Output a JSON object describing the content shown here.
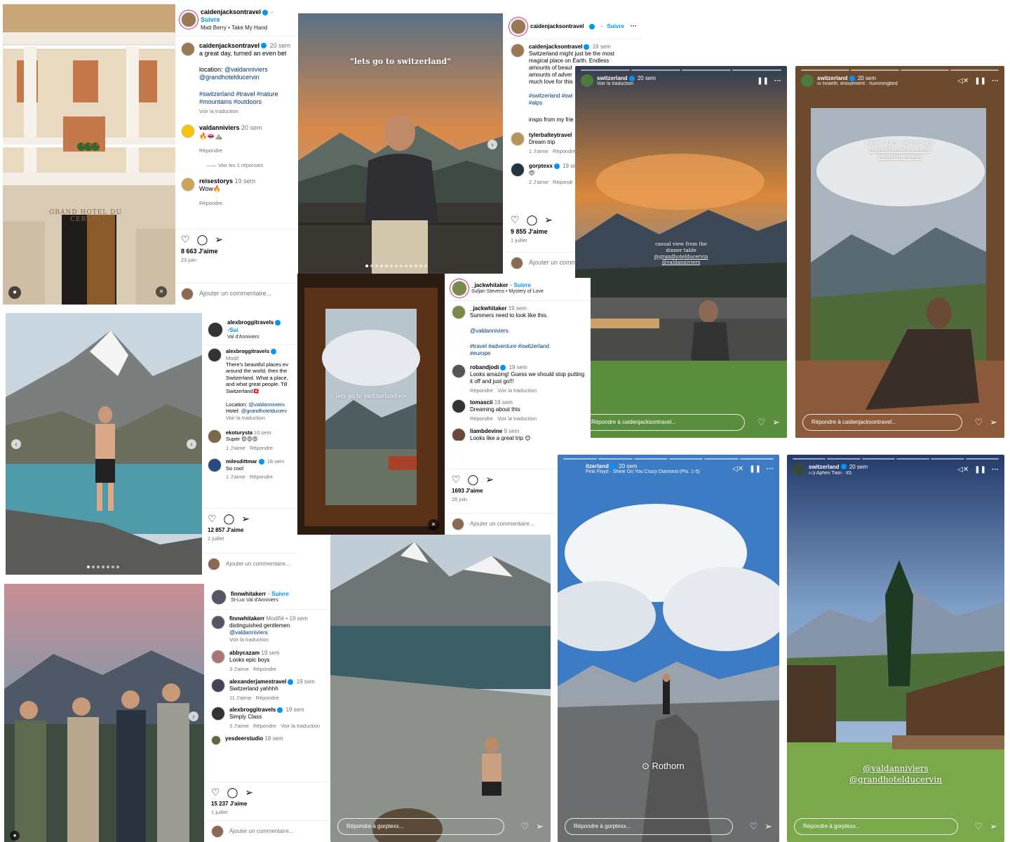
{
  "post1": {
    "username": "caidenjacksontravel",
    "follow": "Suivre",
    "song": "Matt Berry • Take My Hand",
    "caption_user": "caidenjacksontravel",
    "caption_time": "20 sem",
    "caption_text": "a great day, turned an even bet",
    "location_label": "location:",
    "location_tag1": "@valdanniviers",
    "location_tag2": "@grandhotelducervin",
    "hashtags1": "#switzerland #travel #nature",
    "hashtags2": "#mountains #outdoors",
    "translate": "Voir la traduction",
    "comments": [
      {
        "user": "valdanniviers",
        "time": "20 sem",
        "text": "🔥👄⛰️",
        "reply": "Répondre",
        "view_replies": "Voir les 1 réponses"
      },
      {
        "user": "reisestorys",
        "time": "19 sem",
        "text": "Wow🔥",
        "reply": "Répondre"
      }
    ],
    "likes": "8 663 J'aime",
    "date": "23 juin",
    "add_comment": "Ajouter un commentaire...",
    "sign_text": "GRAND HOTEL DU CERVIN"
  },
  "post2": {
    "overlay": "\"lets go to switzerland\""
  },
  "post3": {
    "username": "caidenjacksontravel",
    "follow": "Suivre",
    "caption_user": "caidenjacksontravel",
    "caption_time": "19 sem",
    "caption_lines": [
      "Switzerland might just be the most",
      "magical place on Earth. Endless",
      "amounts of beaut",
      "amounts of adver",
      "much love for this"
    ],
    "hashtags1": "#switzerland #swi",
    "hashtags2": "#alps",
    "inspo": "inspo from my frie",
    "comments": [
      {
        "user": "tylerbalteytravel",
        "text": "Dream trip",
        "likes": "1 J'aime",
        "reply": "Répondre"
      },
      {
        "user": "gorptexx",
        "time": "19 se",
        "text": "😍",
        "likes": "2 J'aime",
        "reply": "Répondr"
      }
    ],
    "likes": "9 855 J'aime",
    "date": "1 juillet",
    "add_comment": "Ajouter un comm"
  },
  "story1": {
    "name": "switzerland",
    "time": "20 sem",
    "sub": "Voir la traduction",
    "overlay_lines": [
      "casual view from the",
      "dinner table",
      "@grandhotelducervin",
      "@valdanniviers"
    ],
    "reply": "Répondre à caidenjacksontravel..."
  },
  "story2": {
    "name": "switzerland",
    "time": "20 sem",
    "song": "hiraeth, énouement · hummingbird",
    "overlay_lines": [
      "ended up in switzerland",
      "@grandhotelducervin",
      "@valdanniviers"
    ],
    "reply": "Répondre à caidenjacksontravel..."
  },
  "post4": {
    "username": "alexbroggitravels",
    "follow": "Sui",
    "location": "Val d'Anniviers",
    "caption_user": "alexbroggitravels",
    "caption_time": "Modif",
    "caption_lines": [
      "There's beautiful places ev",
      "around the world, then the",
      "Switzerland. What a place,",
      "and what great people. Till",
      "Switzerland🇨🇭"
    ],
    "loc_label": "Location:",
    "loc_tag": "@valdanniviers",
    "hotel_label": "Hotel:",
    "hotel_tag": "@grandhotelducerv",
    "translate": "Voir la traduction",
    "comments": [
      {
        "user": "ekoturysta",
        "time": "10 sem",
        "text": "Super 😍😍😍",
        "likes": "1 J'aime",
        "reply": "Répondre"
      },
      {
        "user": "milesdittmar",
        "time": "18 sem",
        "text": "So cool",
        "likes": "1 J'aime",
        "reply": "Répondre"
      }
    ],
    "likes": "12 857 J'aime",
    "date": "2 juillet",
    "add_comment": "Ajouter un commentaire..."
  },
  "post5": {
    "overlay": "lets go to switzerland>>",
    "username": "_jackwhitaker",
    "follow": "Suivre",
    "song": "Sufjan Stevens • Mystery of Love",
    "caption_user": "_jackwhitaker",
    "caption_time": "19 sem",
    "caption_text": "Summers need to look like this.",
    "tag": "@valdanniviers",
    "hashtags1": "#travel #adventure #switzerland",
    "hashtags2": "#europe",
    "comments": [
      {
        "user": "robandjodi",
        "time": "19 sem",
        "text": "Looks amazing! Guess we should stop putting it off and just go!!!",
        "reply": "Répondre",
        "translate": "Voir la traduction"
      },
      {
        "user": "tomascii",
        "time": "19 sem",
        "text": "Dreaming about this",
        "reply": "Répondre",
        "translate": "Voir la traduction"
      },
      {
        "user": "liambdevine",
        "time": "9 sem",
        "text": "Looks like a great trip 😊"
      }
    ],
    "likes": "1693 J'aime",
    "date": "26 juin",
    "add_comment": "Ajouter un commentaire..."
  },
  "post6": {
    "username": "finnwhitakerr",
    "follow": "Suivre",
    "location": "St-Luc Val d'Anniviers",
    "caption_user": "finnwhitakerr",
    "caption_time": "Modifié • 19 sem",
    "caption_text": "distinguished gentlemen",
    "tag": "@valdanniviers",
    "translate": "Voir la traduction",
    "comments": [
      {
        "user": "abbycazam",
        "time": "19 sem",
        "text": "Looks epic boys",
        "likes": "3 J'aime",
        "reply": "Répondre"
      },
      {
        "user": "alexanderjamestravel",
        "time": "19 sem",
        "text": "Switzerland yahhhh",
        "likes": "11 J'aime",
        "reply": "Répondre"
      },
      {
        "user": "alexbroggitravels",
        "time": "19 sem",
        "text": "Simply Class",
        "likes": "3 J'aime",
        "reply": "Répondre",
        "translate": "Voir la traduction"
      },
      {
        "user": "yesdeerstudio",
        "time": "18 sem",
        "text": ""
      }
    ],
    "likes": "15 237 J'aime",
    "date": "1 juillet",
    "add_comment": "Ajouter un commentaire..."
  },
  "story3": {
    "reply": "Répondre à gorptexx..."
  },
  "story4": {
    "name": "itzerland",
    "time": "20 sem",
    "song": "Pink Floyd · Shine On You Crazy Diamond (Pts. 1-5)",
    "location_sticker": "Rothorn",
    "reply": "Répondre à gorptexx..."
  },
  "story5": {
    "name": "switzerland",
    "time": "20 sem",
    "song": "Aphex Twin · #3",
    "overlay_lines": [
      "@valdanniviers",
      "@grandhotelducervin"
    ],
    "reply": "Répondre à gorptexx..."
  },
  "icons": {
    "heart": "heart-icon",
    "comment": "comment-icon",
    "share": "share-icon",
    "bookmark": "bookmark-icon",
    "more": "more-icon",
    "pause": "pause-icon",
    "mute": "mute-icon"
  },
  "colors": {
    "link": "#00376b",
    "follow": "#0095f6",
    "verified": "#0095f6"
  }
}
